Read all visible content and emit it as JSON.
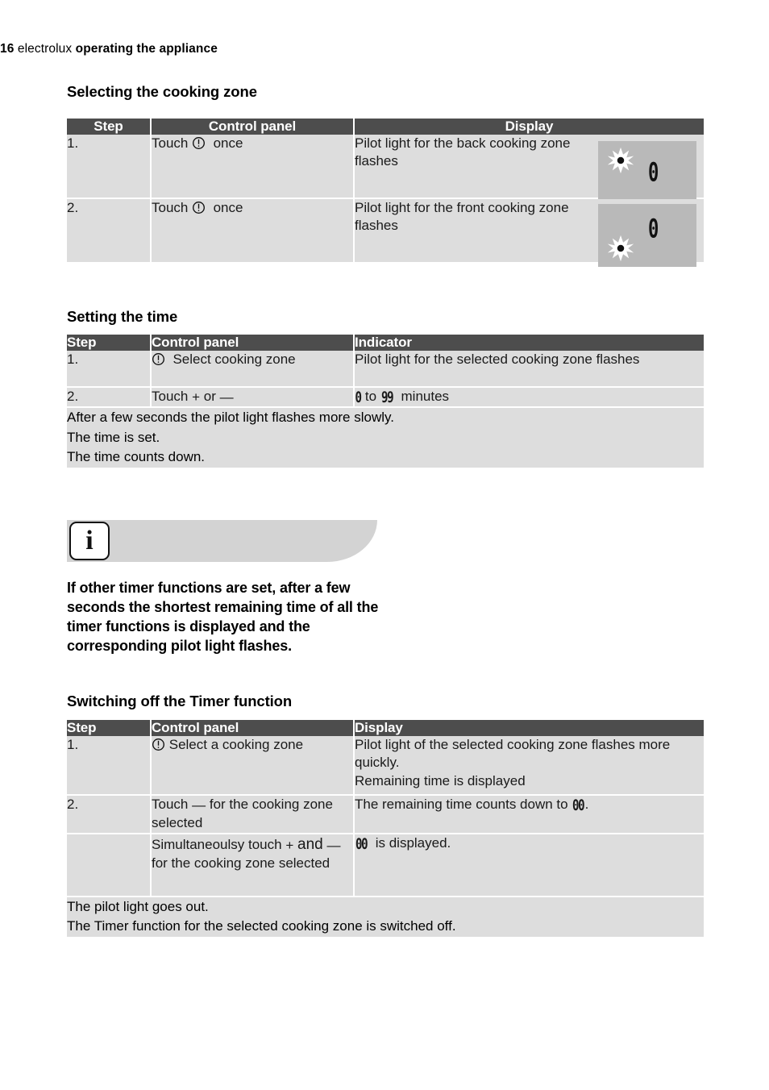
{
  "header": {
    "page_number": "16",
    "brand": "electrolux",
    "section": "operating the appliance"
  },
  "sections": [
    {
      "heading": "Selecting the cooking zone",
      "columns": [
        "Step",
        "Control panel",
        "Display"
      ],
      "rows": [
        {
          "step": "1.",
          "control_prefix": "Touch",
          "control_icon": "timer-icon",
          "control_suffix": "once",
          "display_text": "Pilot light for the back cooking zone flashes",
          "display_graphic": {
            "pilot_position": "back",
            "digit": "0"
          }
        },
        {
          "step": "2.",
          "control_prefix": "Touch",
          "control_icon": "timer-icon",
          "control_suffix": "once",
          "display_text": "Pilot light for the front cooking zone flashes",
          "display_graphic": {
            "pilot_position": "front",
            "digit": "0"
          }
        }
      ]
    },
    {
      "heading": "Setting the time",
      "columns": [
        "Step",
        "Control panel",
        "Indicator"
      ],
      "rows": [
        {
          "step": "1.",
          "control_icon": "timer-icon",
          "control_text": "Select cooking zone",
          "indicator_text": "Pilot light for the selected cooking zone flashes"
        },
        {
          "step": "2.",
          "control_touch": "Touch",
          "control_plus": "+",
          "control_or": "or",
          "control_minus": "—",
          "indicator_from": "0",
          "indicator_to_word": "to",
          "indicator_to": "99",
          "indicator_unit": "minutes"
        }
      ],
      "note": [
        "After a few seconds the pilot light flashes more slowly.",
        "The time is set.",
        "The time counts down."
      ]
    },
    {
      "heading": "Switching off the Timer function",
      "columns": [
        "Step",
        "Control panel",
        "Display"
      ],
      "rows": [
        {
          "step": "1.",
          "control_icon": "timer-icon",
          "control_text": "Select a cooking zone",
          "display_lines": [
            "Pilot light of the selected cooking zone flashes more quickly.",
            "Remaining time is displayed"
          ]
        },
        {
          "step": "2.",
          "control_pre": "Touch",
          "control_minus": "—",
          "control_post": "for the cooking zone selected",
          "display_pre": "The remaining time counts down to",
          "display_digits": "00",
          "display_post": "."
        },
        {
          "step": "",
          "control_pre": "Simultaneoulsy touch",
          "control_plus": "+",
          "control_and": "and",
          "control_minus": "—",
          "control_post": "for the cooking zone selected",
          "display_digits": "00",
          "display_post2": "is displayed."
        }
      ],
      "note": [
        "The pilot light goes out.",
        "The Timer function for the selected cooking zone is switched off."
      ]
    }
  ],
  "info_box": {
    "icon": "information-icon",
    "glyph": "i",
    "body": "If other timer functions are set, after a few seconds the shortest remaining time of all the timer functions is displayed and the corresponding pilot light flashes."
  },
  "colors": {
    "table_header": "#4d4d4d",
    "row_background": "#dddddd",
    "display_panel": "#b9b9b9",
    "info_banner": "#d3d3d3"
  }
}
